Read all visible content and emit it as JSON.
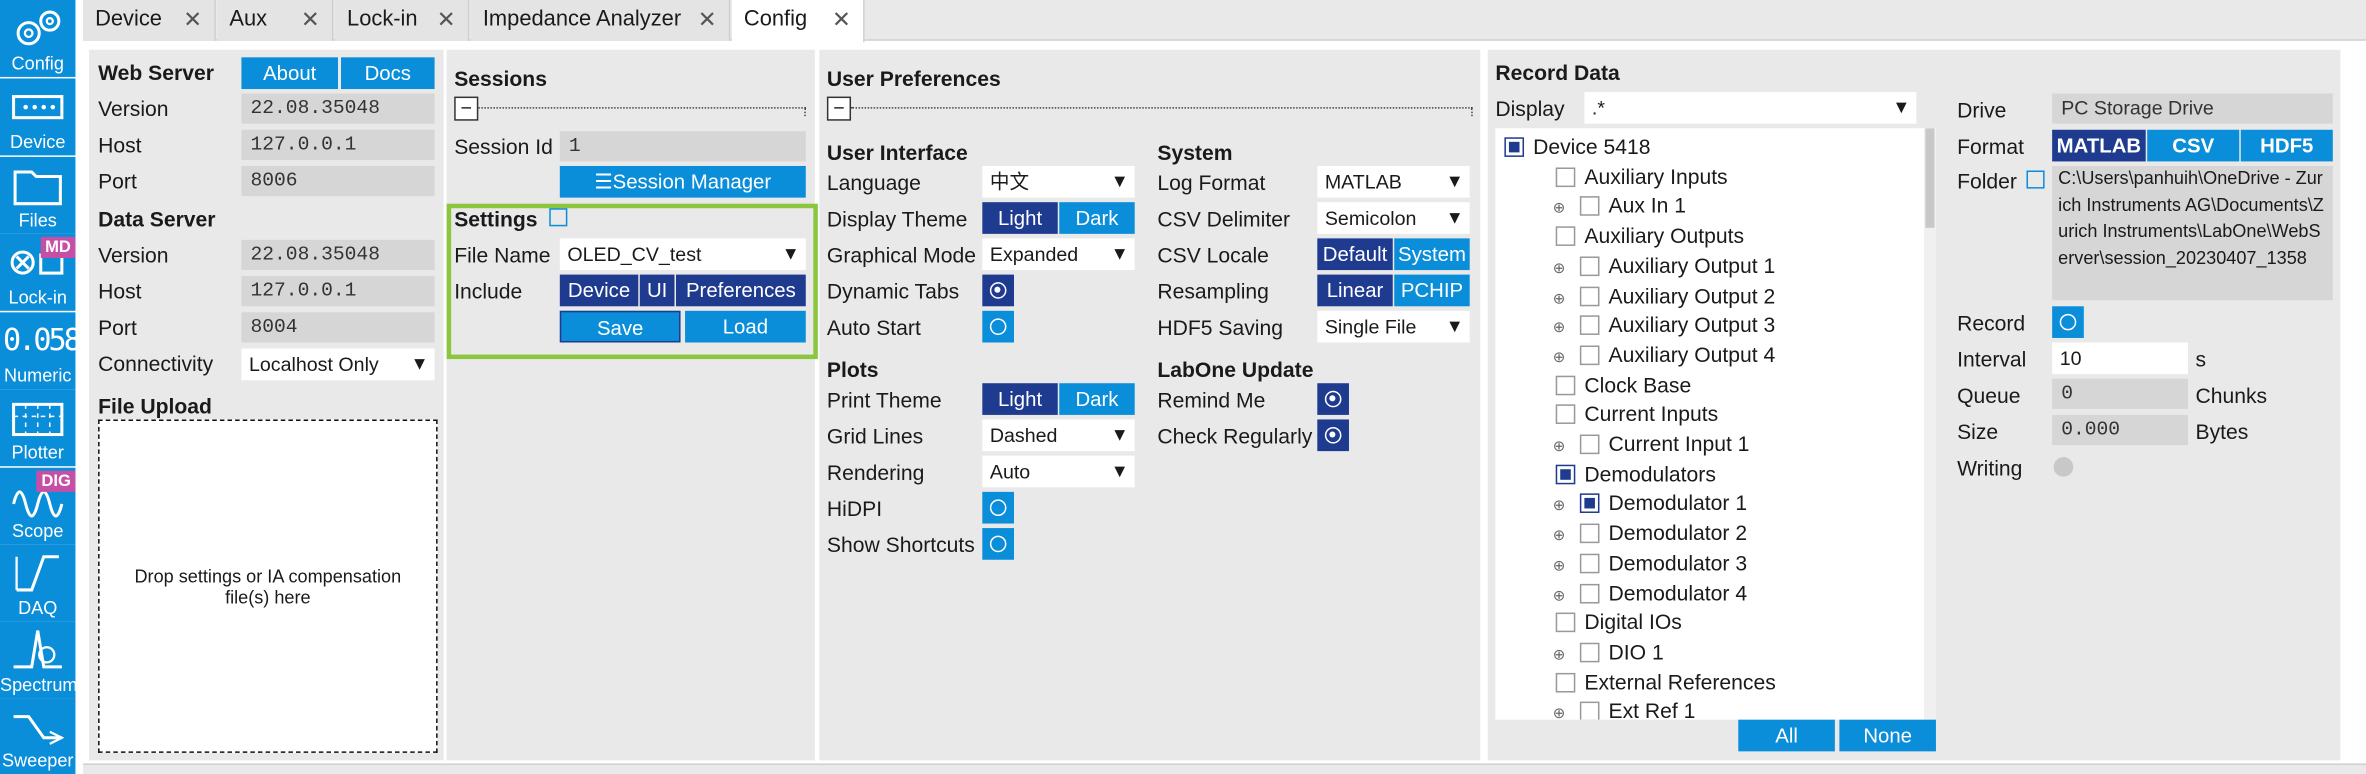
{
  "sidebar": {
    "items": [
      {
        "label": "Config",
        "badge": ""
      },
      {
        "label": "Device",
        "badge": ""
      },
      {
        "label": "Files",
        "badge": ""
      },
      {
        "label": "Lock-in",
        "badge": "MD"
      },
      {
        "label": "Numeric",
        "badge": ""
      },
      {
        "label": "Plotter",
        "badge": ""
      },
      {
        "label": "Scope",
        "badge": "DIG"
      },
      {
        "label": "DAQ",
        "badge": ""
      },
      {
        "label": "Spectrum",
        "badge": ""
      },
      {
        "label": "Sweeper",
        "badge": ""
      }
    ],
    "numeric_glyph": "0.058"
  },
  "tabs": [
    {
      "label": "Device"
    },
    {
      "label": "Aux"
    },
    {
      "label": "Lock-in"
    },
    {
      "label": "Impedance Analyzer"
    },
    {
      "label": "Config"
    }
  ],
  "web_server": {
    "title": "Web Server",
    "about_label": "About",
    "docs_label": "Docs",
    "version_label": "Version",
    "version": "22.08.35048",
    "host_label": "Host",
    "host": "127.0.0.1",
    "port_label": "Port",
    "port": "8006"
  },
  "data_server": {
    "title": "Data Server",
    "version_label": "Version",
    "version": "22.08.35048",
    "host_label": "Host",
    "host": "127.0.0.1",
    "port_label": "Port",
    "port": "8004",
    "connectivity_label": "Connectivity",
    "connectivity": "Localhost Only"
  },
  "file_upload": {
    "title": "File Upload",
    "drop_text": "Drop settings or IA compensation file(s) here"
  },
  "sessions": {
    "title": "Sessions",
    "session_id_label": "Session Id",
    "session_id": "1",
    "manager_label": "☰Session Manager",
    "settings_title": "Settings",
    "file_name_label": "File Name",
    "file_name": "OLED_CV_test",
    "include_label": "Include",
    "include_options": [
      "Device",
      "UI",
      "Preferences"
    ],
    "save_label": "Save",
    "load_label": "Load"
  },
  "user_prefs": {
    "title": "User Preferences",
    "ui": {
      "title": "User Interface",
      "language_label": "Language",
      "language": "中文",
      "display_theme_label": "Display Theme",
      "theme_light": "Light",
      "theme_dark": "Dark",
      "graphical_mode_label": "Graphical Mode",
      "graphical_mode": "Expanded",
      "dynamic_tabs_label": "Dynamic Tabs",
      "auto_start_label": "Auto Start"
    },
    "system": {
      "title": "System",
      "log_format_label": "Log Format",
      "log_format": "MATLAB",
      "csv_delimiter_label": "CSV Delimiter",
      "csv_delimiter": "Semicolon",
      "csv_locale_label": "CSV Locale",
      "locale_default": "Default",
      "locale_system": "System",
      "resampling_label": "Resampling",
      "resampling_linear": "Linear",
      "resampling_pchip": "PCHIP",
      "hdf5_label": "HDF5 Saving",
      "hdf5": "Single File"
    },
    "plots": {
      "title": "Plots",
      "print_theme_label": "Print Theme",
      "print_light": "Light",
      "print_dark": "Dark",
      "grid_lines_label": "Grid Lines",
      "grid_lines": "Dashed",
      "rendering_label": "Rendering",
      "rendering": "Auto",
      "hidpi_label": "HiDPI",
      "shortcuts_label": "Show Shortcuts"
    },
    "update": {
      "title": "LabOne Update",
      "remind_label": "Remind Me",
      "check_label": "Check Regularly"
    }
  },
  "record": {
    "title": "Record Data",
    "display_label": "Display",
    "display_value": ".*",
    "tree": [
      {
        "label": "Device 5418",
        "level": 0,
        "checked": true,
        "expander": false
      },
      {
        "label": "Auxiliary Inputs",
        "level": 1,
        "checked": false,
        "expander": false
      },
      {
        "label": "Aux In 1",
        "level": 2,
        "checked": false,
        "expander": true
      },
      {
        "label": "Auxiliary Outputs",
        "level": 1,
        "checked": false,
        "expander": false
      },
      {
        "label": "Auxiliary Output 1",
        "level": 2,
        "checked": false,
        "expander": true
      },
      {
        "label": "Auxiliary Output 2",
        "level": 2,
        "checked": false,
        "expander": true
      },
      {
        "label": "Auxiliary Output 3",
        "level": 2,
        "checked": false,
        "expander": true
      },
      {
        "label": "Auxiliary Output 4",
        "level": 2,
        "checked": false,
        "expander": true
      },
      {
        "label": "Clock Base",
        "level": 1,
        "checked": false,
        "expander": false
      },
      {
        "label": "Current Inputs",
        "level": 1,
        "checked": false,
        "expander": false
      },
      {
        "label": "Current Input 1",
        "level": 2,
        "checked": false,
        "expander": true
      },
      {
        "label": "Demodulators",
        "level": 1,
        "checked": true,
        "expander": false
      },
      {
        "label": "Demodulator 1",
        "level": 2,
        "checked": true,
        "expander": true
      },
      {
        "label": "Demodulator 2",
        "level": 2,
        "checked": false,
        "expander": true
      },
      {
        "label": "Demodulator 3",
        "level": 2,
        "checked": false,
        "expander": true
      },
      {
        "label": "Demodulator 4",
        "level": 2,
        "checked": false,
        "expander": true
      },
      {
        "label": "Digital IOs",
        "level": 1,
        "checked": false,
        "expander": false
      },
      {
        "label": "DIO 1",
        "level": 2,
        "checked": false,
        "expander": true
      },
      {
        "label": "External References",
        "level": 1,
        "checked": false,
        "expander": false
      },
      {
        "label": "Ext Ref 1",
        "level": 2,
        "checked": false,
        "expander": true
      }
    ],
    "all_label": "All",
    "none_label": "None",
    "drive_label": "Drive",
    "drive": "PC Storage Drive",
    "format_label": "Format",
    "format_options": [
      "MATLAB",
      "CSV",
      "HDF5"
    ],
    "folder_label": "Folder",
    "folder": "C:\\Users\\panhuih\\OneDrive - Zurich Instruments AG\\Documents\\Zurich Instruments\\LabOne\\WebServer\\session_20230407_1358",
    "record_label": "Record",
    "interval_label": "Interval",
    "interval": "10",
    "interval_unit": "s",
    "queue_label": "Queue",
    "queue": "0",
    "queue_unit": "Chunks",
    "size_label": "Size",
    "size": "0.000",
    "size_unit": "Bytes",
    "writing_label": "Writing"
  },
  "colors": {
    "accent": "#0b8ed9",
    "selected": "#1f3b8f",
    "highlight": "#8cc63f",
    "badge": "#c64fa6"
  }
}
